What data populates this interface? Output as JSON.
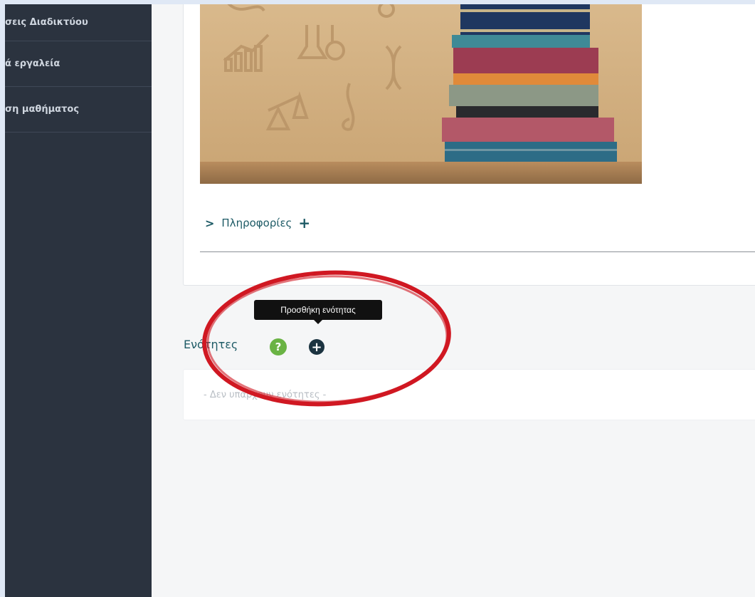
{
  "sidebar": {
    "items": [
      {
        "label": "σεις Διαδικτύου"
      },
      {
        "label": "ά εργαλεία"
      },
      {
        "label": "ση μαθήματος"
      }
    ]
  },
  "card": {
    "info_label": "Πληροφορίες",
    "info_chevron": ">",
    "info_plus": "+"
  },
  "sections": {
    "title": "Ενότητες",
    "help_glyph": "?",
    "add_glyph": "+",
    "tooltip": "Προσθήκη ενότητας",
    "empty_text": "- Δεν υπάρχουν ενότητες -"
  },
  "colors": {
    "sidebar_bg": "#2b333f",
    "accent_teal": "#1e5b66",
    "help_green": "#6ab344",
    "annotation_red": "#d01822"
  }
}
